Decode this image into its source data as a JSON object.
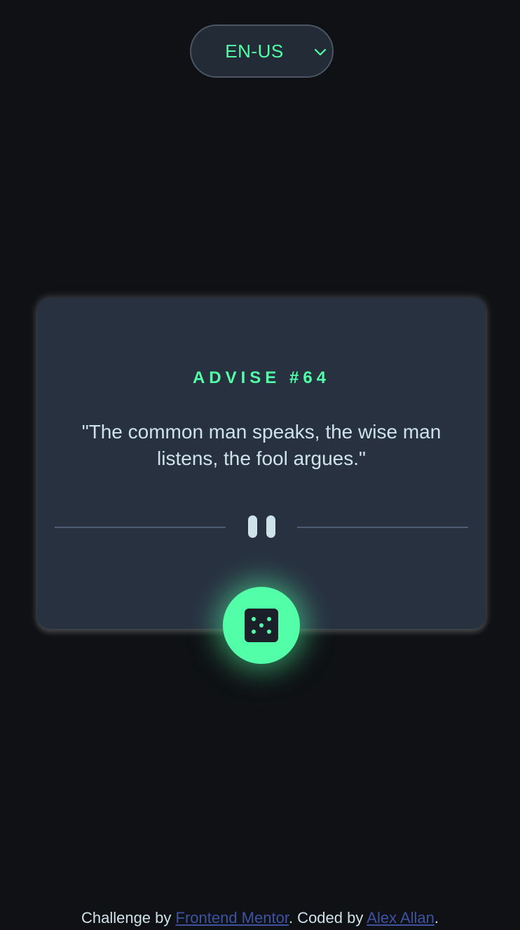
{
  "language_select": {
    "value": "EN-US",
    "icon": "chevron-down-icon"
  },
  "card": {
    "title": "ADVISE #64",
    "quote": "\"The common man speaks, the wise man listens, the fool argues.\"",
    "divider_icon": "pause-icon"
  },
  "dice_button": {
    "icon": "dice-icon"
  },
  "footer": {
    "prefix": "Challenge by ",
    "link1": "Frontend Mentor",
    "middle": ". Coded by ",
    "link2": "Alex Allan",
    "suffix": "."
  },
  "colors": {
    "background": "#0f1114",
    "card": "#283140",
    "accent": "#52ffa8",
    "text": "#cee3e9",
    "link": "#3e52a3"
  }
}
